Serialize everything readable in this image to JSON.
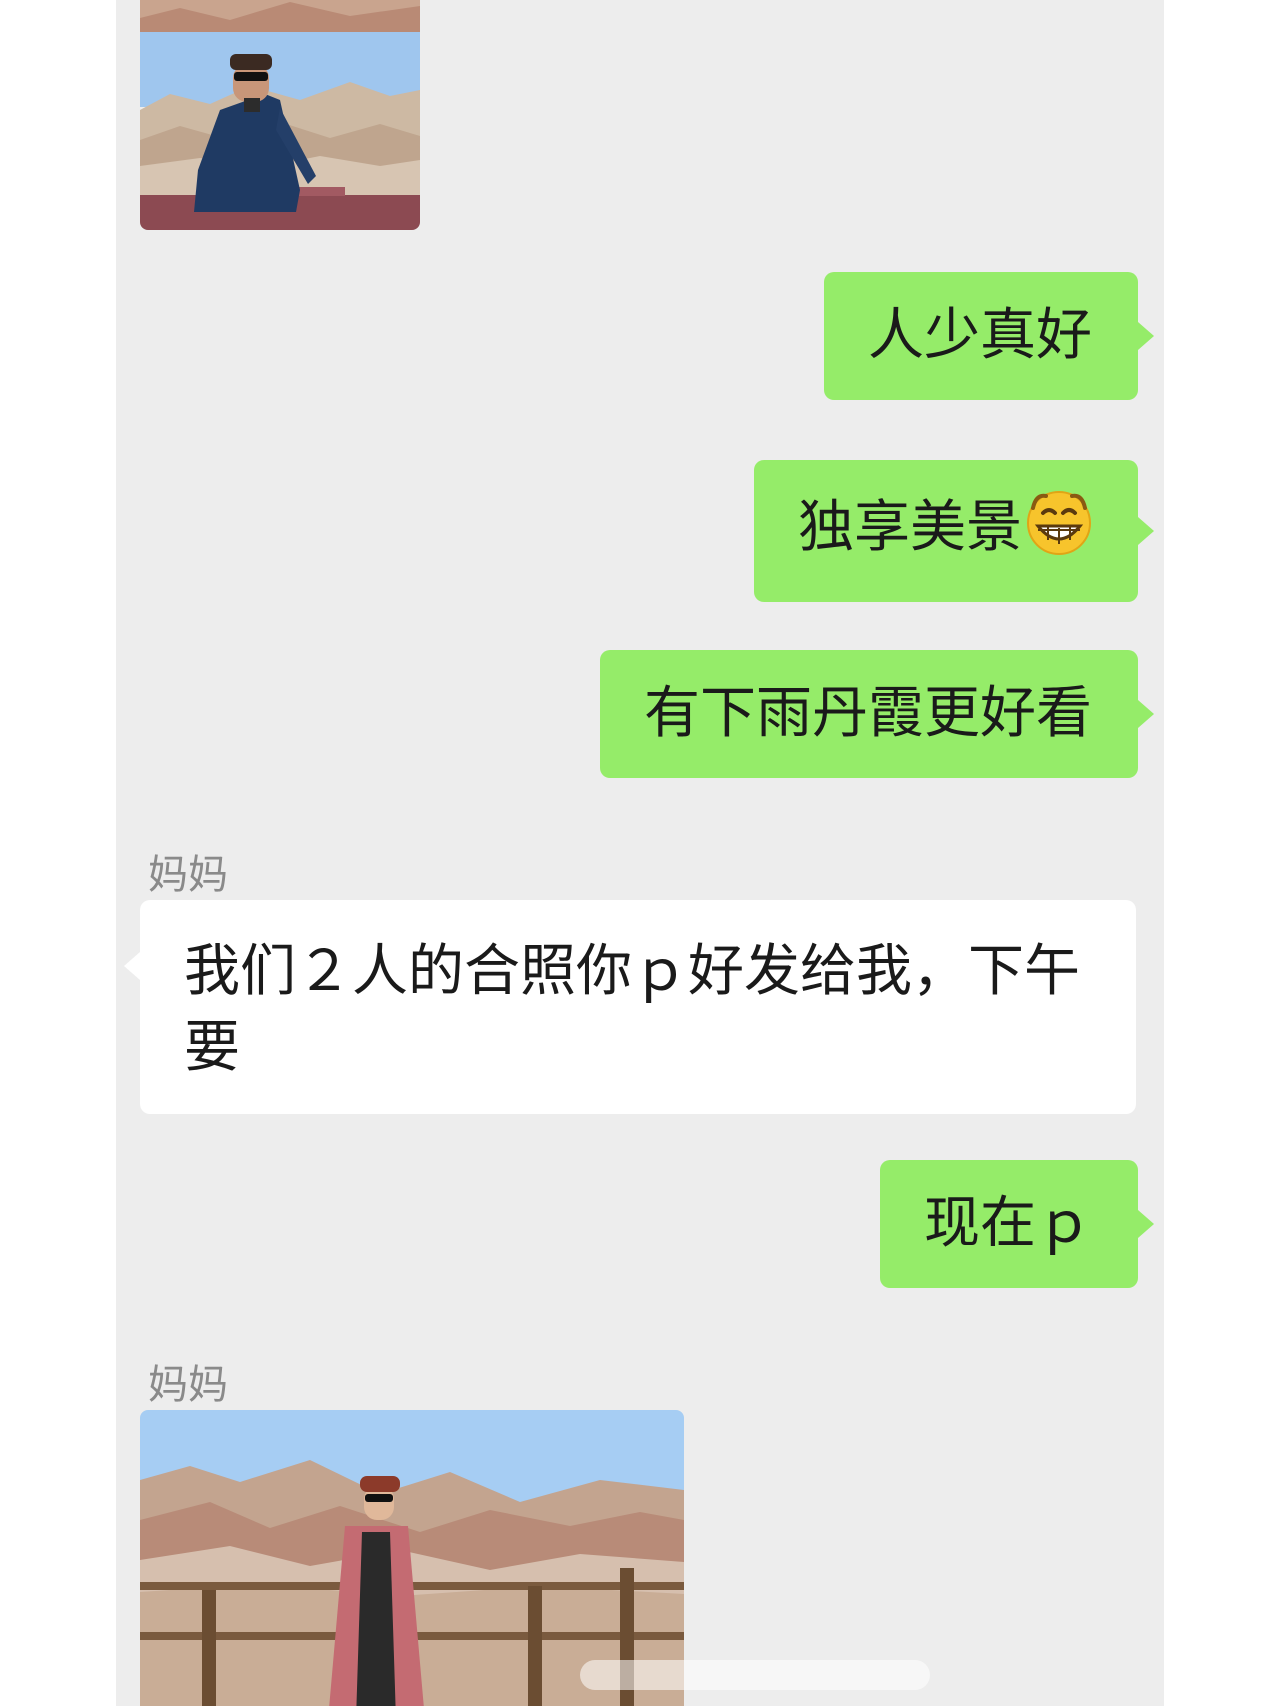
{
  "messages": [
    {
      "direction": "out",
      "text": "人少真好"
    },
    {
      "direction": "out",
      "text": "独享美景",
      "emoji": "grinning-face-emoji"
    },
    {
      "direction": "out",
      "text": "有下雨丹霞更好看"
    },
    {
      "direction": "in",
      "sender": "妈妈",
      "text": "我们２人的合照你ｐ好发给我，下午要"
    },
    {
      "direction": "out",
      "text": "现在ｐ"
    },
    {
      "direction": "in",
      "sender": "妈妈",
      "type": "photo"
    }
  ],
  "colors": {
    "chat_background": "#ededed",
    "outgoing_bubble": "#95ec69",
    "incoming_bubble": "#ffffff",
    "sender_name": "#8a8a8a"
  }
}
